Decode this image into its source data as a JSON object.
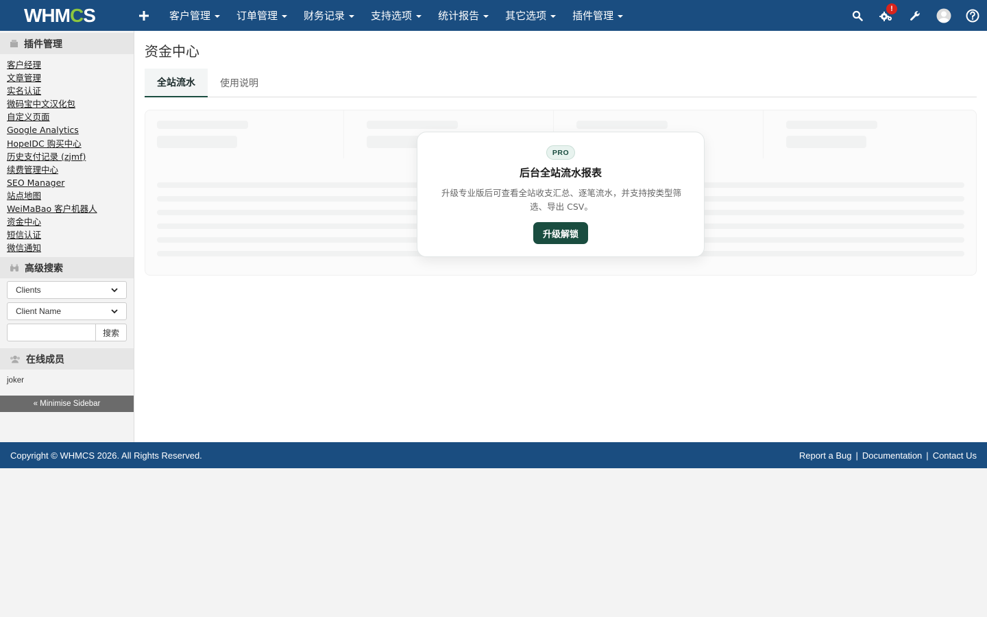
{
  "brand": {
    "logo_pre": "WHM",
    "logo_gear": "C",
    "logo_post": "S"
  },
  "nav": {
    "add_icon": "plus-icon",
    "items": [
      {
        "label": "客户管理"
      },
      {
        "label": "订单管理"
      },
      {
        "label": "财务记录"
      },
      {
        "label": "支持选项"
      },
      {
        "label": "统计报告"
      },
      {
        "label": "其它选项"
      },
      {
        "label": "插件管理"
      }
    ],
    "notification_badge": "!"
  },
  "sidebar": {
    "addons_title": "插件管理",
    "addons": [
      "客户经理",
      "文章管理",
      "实名认证",
      "微码宝中文汉化包",
      "自定义页面",
      "Google Analytics",
      "HopeIDC 购买中心",
      "历史支付记录 (zjmf)",
      "续费管理中心",
      "SEO Manager",
      "站点地图",
      "WeiMaBao 客户机器人",
      "资金中心",
      "短信认证",
      "微信通知"
    ],
    "search_title": "高级搜索",
    "search_type": "Clients",
    "search_field": "Client Name",
    "search_value": "",
    "search_button": "搜索",
    "online_title": "在线成员",
    "online_users": [
      "joker"
    ],
    "minimise": "« Minimise Sidebar"
  },
  "main": {
    "title": "资金中心",
    "tabs": [
      {
        "label": "全站流水",
        "active": true
      },
      {
        "label": "使用说明",
        "active": false
      }
    ],
    "upgrade": {
      "badge": "PRO",
      "title": "后台全站流水报表",
      "description": "升级专业版后可查看全站收支汇总、逐笔流水，并支持按类型筛选、导出 CSV。",
      "button": "升级解锁"
    }
  },
  "footer": {
    "copyright": "Copyright © WHMCS 2026. All Rights Reserved.",
    "links": [
      "Report a Bug",
      "Documentation",
      "Contact Us"
    ],
    "separator": "|"
  },
  "colors": {
    "navbar": "#1a4d80",
    "accent_green": "#1a4d40",
    "badge_red": "#d9241c",
    "logo_gear": "#8dc63f"
  }
}
